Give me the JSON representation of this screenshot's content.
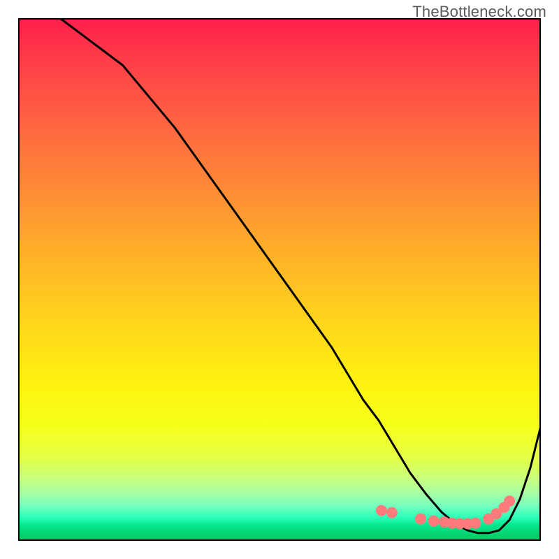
{
  "watermark": "TheBottleneck.com",
  "chart_data": {
    "type": "line",
    "title": "",
    "xlabel": "",
    "ylabel": "",
    "xlim": [
      0,
      100
    ],
    "ylim": [
      0,
      100
    ],
    "curve": {
      "name": "bottleneck-curve",
      "x": [
        8,
        12,
        16,
        20,
        25,
        30,
        35,
        40,
        45,
        50,
        55,
        60,
        63,
        66,
        69,
        72,
        75,
        78,
        81,
        84,
        86,
        88,
        90,
        92,
        94,
        96,
        98,
        100
      ],
      "y": [
        100,
        97,
        94,
        91,
        85,
        79,
        72,
        65,
        58,
        51,
        44,
        37,
        32,
        27,
        23,
        18,
        13,
        9,
        5.5,
        3,
        2,
        1.5,
        1.5,
        2,
        4,
        8,
        14,
        22
      ]
    },
    "markers": {
      "name": "highlight-dots",
      "color": "#ff7a7a",
      "x": [
        69.5,
        71.5,
        77,
        79.5,
        81.5,
        83,
        84.5,
        86,
        87.5,
        90,
        91.5,
        93,
        94
      ],
      "y": [
        5.8,
        5.4,
        4.2,
        3.8,
        3.6,
        3.4,
        3.3,
        3.3,
        3.4,
        4.2,
        5.2,
        6.4,
        7.6
      ]
    },
    "gradient_bottom_color": "#05c860",
    "gradient_top_color": "#ff1f4b"
  }
}
